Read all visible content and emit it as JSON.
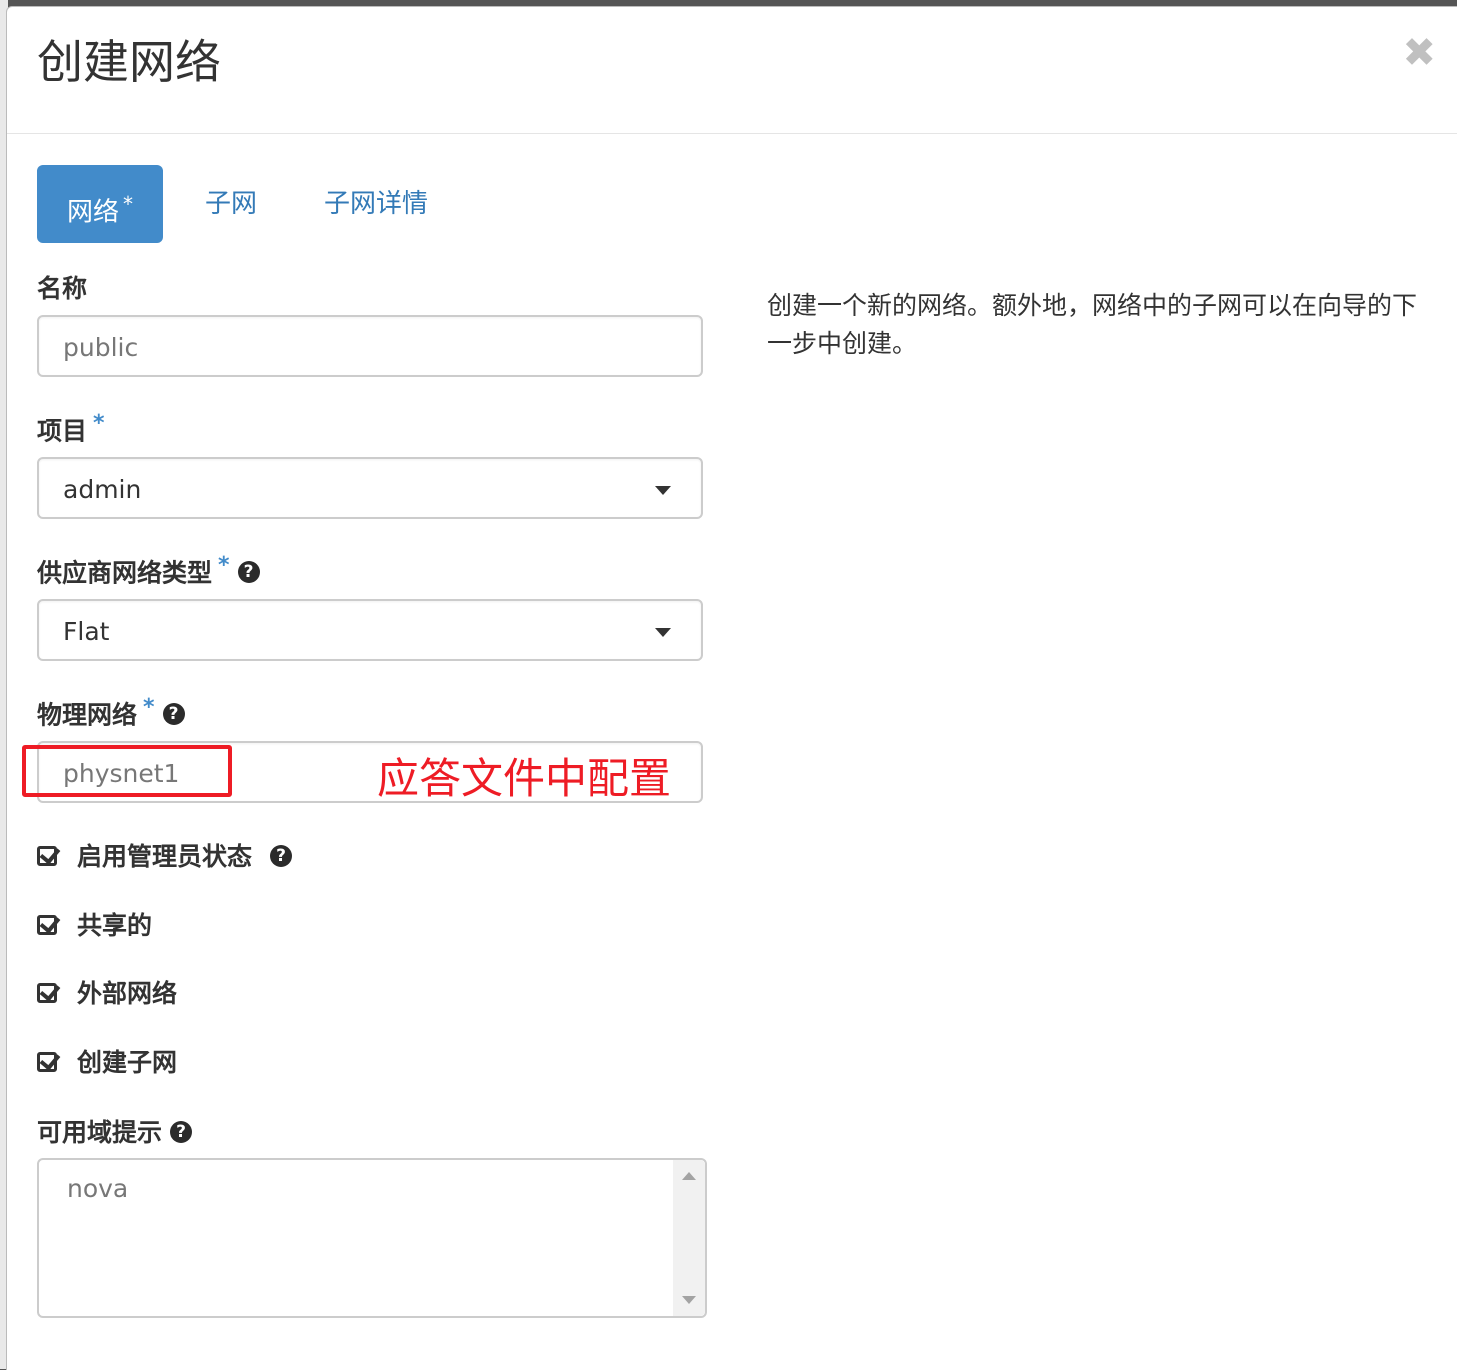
{
  "modal": {
    "title": "创建网络",
    "close_glyph": "✖"
  },
  "tabs": [
    {
      "label": "网络",
      "required_mark": "*",
      "active": true
    },
    {
      "label": "子网",
      "active": false
    },
    {
      "label": "子网详情",
      "active": false
    }
  ],
  "form": {
    "name": {
      "label": "名称",
      "placeholder": "public"
    },
    "project": {
      "label": "项目",
      "required_mark": "*",
      "value": "admin"
    },
    "provider_network_type": {
      "label": "供应商网络类型",
      "required_mark": "*",
      "value": "Flat"
    },
    "physical_network": {
      "label": "物理网络",
      "required_mark": "*",
      "placeholder": "physnet1"
    },
    "checkboxes": [
      {
        "label": "启用管理员状态",
        "checked": true,
        "help": true
      },
      {
        "label": "共享的",
        "checked": true
      },
      {
        "label": "外部网络",
        "checked": true
      },
      {
        "label": "创建子网",
        "checked": true
      }
    ],
    "availability_zone_hints": {
      "label": "可用域提示",
      "options": [
        "nova"
      ]
    }
  },
  "description": "创建一个新的网络。额外地，网络中的子网可以在向导的下一步中创建。",
  "annotation": {
    "text": "应答文件中配置",
    "color": "#ee1c25"
  },
  "colors": {
    "accent": "#428bca",
    "link": "#337ab7",
    "annotation": "#ee1c25"
  },
  "icons": {
    "help": "question-circle-icon",
    "checkbox": "check-square-icon",
    "caret": "caret-down-icon",
    "close": "close-icon"
  }
}
